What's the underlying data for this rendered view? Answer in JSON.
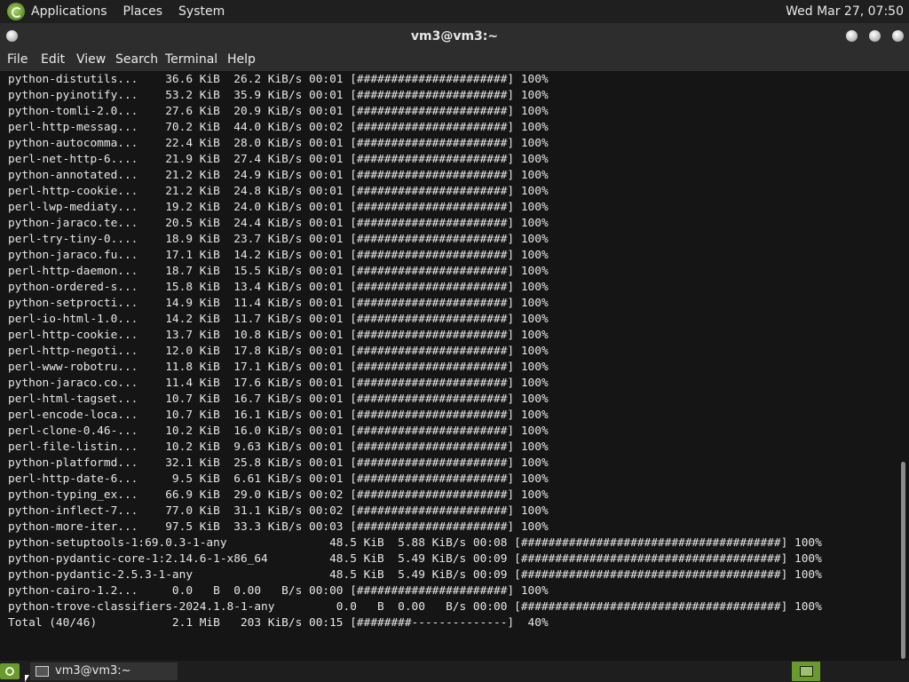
{
  "top_panel": {
    "menus": [
      "Applications",
      "Places",
      "System"
    ],
    "clock": "Wed Mar 27, 07:50"
  },
  "window": {
    "title": "vm3@vm3:~"
  },
  "menu_bar": [
    "File",
    "Edit",
    "View",
    "Search",
    "Terminal",
    "Help"
  ],
  "terminal": {
    "lines": [
      "python-distutils...    36.6 KiB  26.2 KiB/s 00:01 [######################] 100%",
      "python-pyinotify...    53.2 KiB  35.9 KiB/s 00:01 [######################] 100%",
      "python-tomli-2.0...    27.6 KiB  20.9 KiB/s 00:01 [######################] 100%",
      "perl-http-messag...    70.2 KiB  44.0 KiB/s 00:02 [######################] 100%",
      "python-autocomma...    22.4 KiB  28.0 KiB/s 00:01 [######################] 100%",
      "perl-net-http-6....    21.9 KiB  27.4 KiB/s 00:01 [######################] 100%",
      "python-annotated...    21.2 KiB  24.9 KiB/s 00:01 [######################] 100%",
      "perl-http-cookie...    21.2 KiB  24.8 KiB/s 00:01 [######################] 100%",
      "perl-lwp-mediaty...    19.2 KiB  24.0 KiB/s 00:01 [######################] 100%",
      "python-jaraco.te...    20.5 KiB  24.4 KiB/s 00:01 [######################] 100%",
      "perl-try-tiny-0....    18.9 KiB  23.7 KiB/s 00:01 [######################] 100%",
      "python-jaraco.fu...    17.1 KiB  14.2 KiB/s 00:01 [######################] 100%",
      "perl-http-daemon...    18.7 KiB  15.5 KiB/s 00:01 [######################] 100%",
      "python-ordered-s...    15.8 KiB  13.4 KiB/s 00:01 [######################] 100%",
      "python-setprocti...    14.9 KiB  11.4 KiB/s 00:01 [######################] 100%",
      "perl-io-html-1.0...    14.2 KiB  11.7 KiB/s 00:01 [######################] 100%",
      "perl-http-cookie...    13.7 KiB  10.8 KiB/s 00:01 [######################] 100%",
      "perl-http-negoti...    12.0 KiB  17.8 KiB/s 00:01 [######################] 100%",
      "perl-www-robotru...    11.8 KiB  17.1 KiB/s 00:01 [######################] 100%",
      "python-jaraco.co...    11.4 KiB  17.6 KiB/s 00:01 [######################] 100%",
      "perl-html-tagset...    10.7 KiB  16.7 KiB/s 00:01 [######################] 100%",
      "perl-encode-loca...    10.7 KiB  16.1 KiB/s 00:01 [######################] 100%",
      "perl-clone-0.46-...    10.2 KiB  16.0 KiB/s 00:01 [######################] 100%",
      "perl-file-listin...    10.2 KiB  9.63 KiB/s 00:01 [######################] 100%",
      "python-platformd...    32.1 KiB  25.8 KiB/s 00:01 [######################] 100%",
      "perl-http-date-6...     9.5 KiB  6.61 KiB/s 00:01 [######################] 100%",
      "python-typing_ex...    66.9 KiB  29.0 KiB/s 00:02 [######################] 100%",
      "python-inflect-7...    77.0 KiB  31.1 KiB/s 00:02 [######################] 100%",
      "python-more-iter...    97.5 KiB  33.3 KiB/s 00:03 [######################] 100%",
      "python-setuptools-1:69.0.3-1-any               48.5 KiB  5.88 KiB/s 00:08 [######################################] 100%",
      "python-pydantic-core-1:2.14.6-1-x86_64         48.5 KiB  5.49 KiB/s 00:09 [######################################] 100%",
      "python-pydantic-2.5.3-1-any                    48.5 KiB  5.49 KiB/s 00:09 [######################################] 100%",
      "python-cairo-1.2...     0.0   B  0.00   B/s 00:00 [######################] 100%",
      "python-trove-classifiers-2024.1.8-1-any         0.0   B  0.00   B/s 00:00 [######################################] 100%",
      "Total (40/46)           2.1 MiB   203 KiB/s 00:15 [########--------------]  40%"
    ]
  },
  "taskbar": {
    "item_label": "vm3@vm3:~"
  },
  "icons": {
    "apps": "mint-logo-icon",
    "window_menu": "window-menu-icon",
    "minimize": "minimize-icon",
    "maximize": "maximize-icon",
    "close": "close-icon",
    "terminal": "terminal-window-icon",
    "workspace": "workspace-icon"
  },
  "colors": {
    "accent": "#6a9a2e",
    "terminal_bg": "#151515",
    "terminal_fg": "#e6e6e6"
  }
}
